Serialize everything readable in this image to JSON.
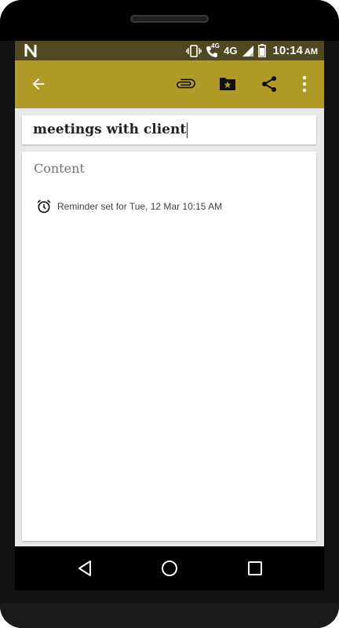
{
  "status_bar": {
    "logo_icon": "n-logo",
    "icons": [
      "vibrate-icon",
      "volte-call-icon",
      "4g-icon",
      "signal-icon",
      "battery-icon"
    ],
    "network_small": "4G",
    "network_label": "4G",
    "time": "10:14",
    "ampm": "AM"
  },
  "toolbar": {
    "color": "#b09a28",
    "back_icon": "arrow-back-icon",
    "attach_icon": "paperclip-icon",
    "folder_icon": "folder-star-icon",
    "share_icon": "share-icon",
    "more_icon": "more-vert-icon"
  },
  "note": {
    "title": "meetings with client",
    "content_placeholder": "Content",
    "reminder_icon": "alarm-icon",
    "reminder_text": "Reminder set for Tue, 12 Mar 10:15 AM"
  },
  "navigation": {
    "back": "nav-back-icon",
    "home": "nav-home-icon",
    "recents": "nav-recents-icon"
  }
}
